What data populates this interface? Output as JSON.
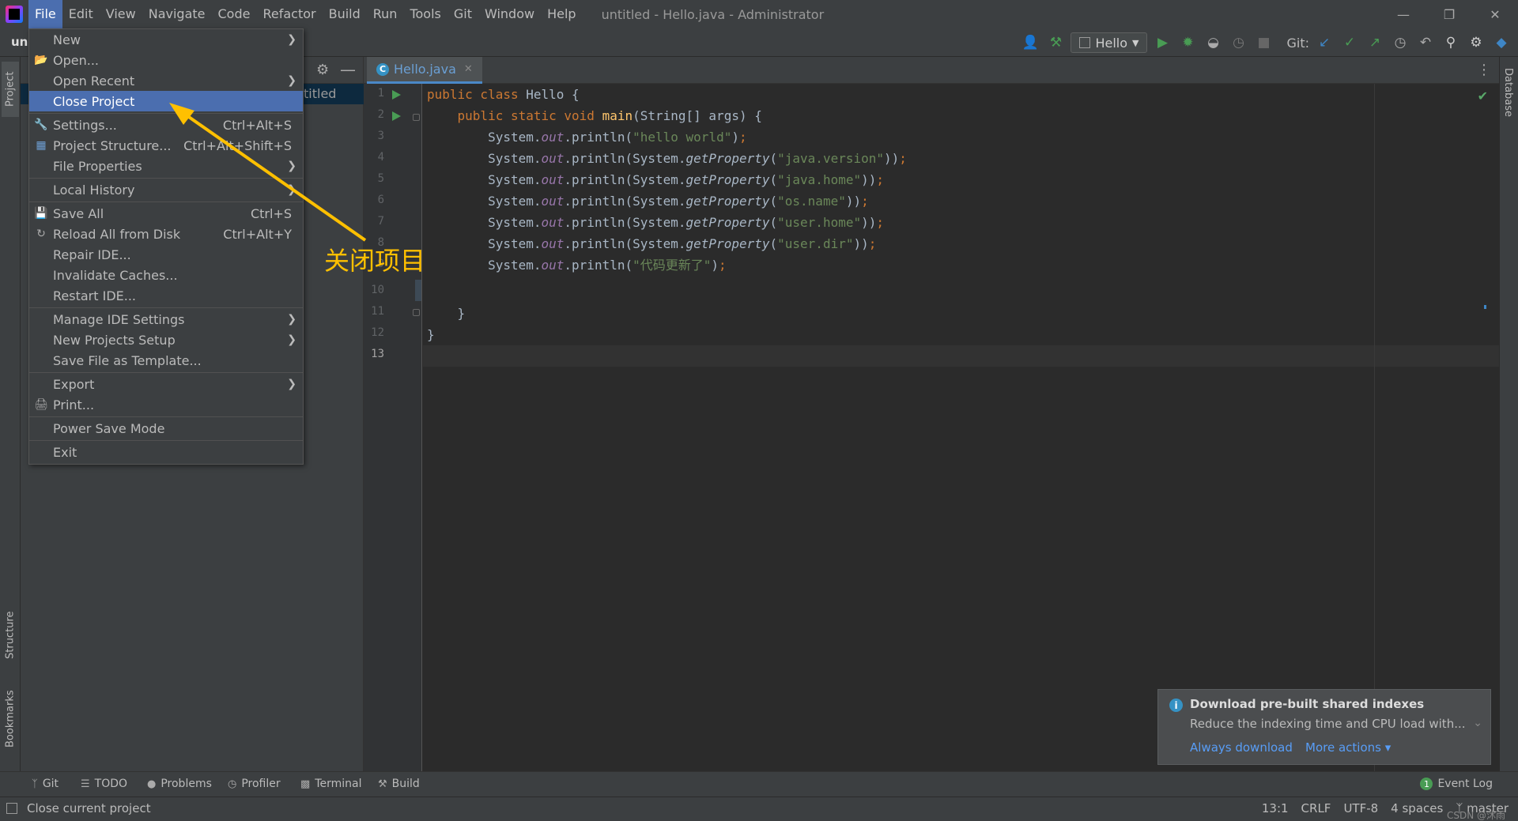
{
  "menubar": {
    "items": [
      "File",
      "Edit",
      "View",
      "Navigate",
      "Code",
      "Refactor",
      "Build",
      "Run",
      "Tools",
      "Git",
      "Window",
      "Help"
    ],
    "active": "File",
    "window_title": "untitled - Hello.java - Administrator"
  },
  "toolbar": {
    "project_name": "un",
    "run_config": "Hello",
    "git_label": "Git:"
  },
  "project_panel": {
    "row_text": "titled"
  },
  "side_tabs": {
    "project": "Project",
    "structure": "Structure",
    "bookmarks": "Bookmarks",
    "database": "Database"
  },
  "editor": {
    "tab_name": "Hello.java",
    "tab_icon": "C",
    "line_numbers": [
      "1",
      "2",
      "3",
      "4",
      "5",
      "6",
      "7",
      "8",
      "9",
      "10",
      "11",
      "12",
      "13"
    ],
    "current_line": "13"
  },
  "file_menu": {
    "new": "New",
    "open": "Open...",
    "open_recent": "Open Recent",
    "close_project": "Close Project",
    "settings": "Settings...",
    "settings_sc": "Ctrl+Alt+S",
    "project_structure": "Project Structure...",
    "project_structure_sc": "Ctrl+Alt+Shift+S",
    "file_properties": "File Properties",
    "local_history": "Local History",
    "save_all": "Save All",
    "save_all_sc": "Ctrl+S",
    "reload_all": "Reload All from Disk",
    "reload_all_sc": "Ctrl+Alt+Y",
    "repair_ide": "Repair IDE...",
    "invalidate_caches": "Invalidate Caches...",
    "restart_ide": "Restart IDE...",
    "manage_ide_settings": "Manage IDE Settings",
    "new_projects_setup": "New Projects Setup",
    "save_file_as_template": "Save File as Template...",
    "export": "Export",
    "print": "Print...",
    "power_save_mode": "Power Save Mode",
    "exit": "Exit"
  },
  "annotation": {
    "text": "关闭项目",
    "color": "#ffc000"
  },
  "notification": {
    "title": "Download pre-built shared indexes",
    "body": "Reduce the indexing time and CPU load with...",
    "link_always": "Always download",
    "link_more": "More actions ▾"
  },
  "bottom_tools": {
    "git": "Git",
    "todo": "TODO",
    "problems": "Problems",
    "profiler": "Profiler",
    "terminal": "Terminal",
    "build": "Build",
    "event_log": "Event Log",
    "event_count": "1"
  },
  "status": {
    "message": "Close current project",
    "position": "13:1",
    "line_sep": "CRLF",
    "encoding": "UTF-8",
    "indent": "4 spaces",
    "branch": "master",
    "watermark": "CSDN @沐雨"
  },
  "colors": {
    "accent": "#4b6eaf",
    "background": "#2b2b2b",
    "panel": "#3c3f41",
    "annotation": "#ffc000"
  }
}
